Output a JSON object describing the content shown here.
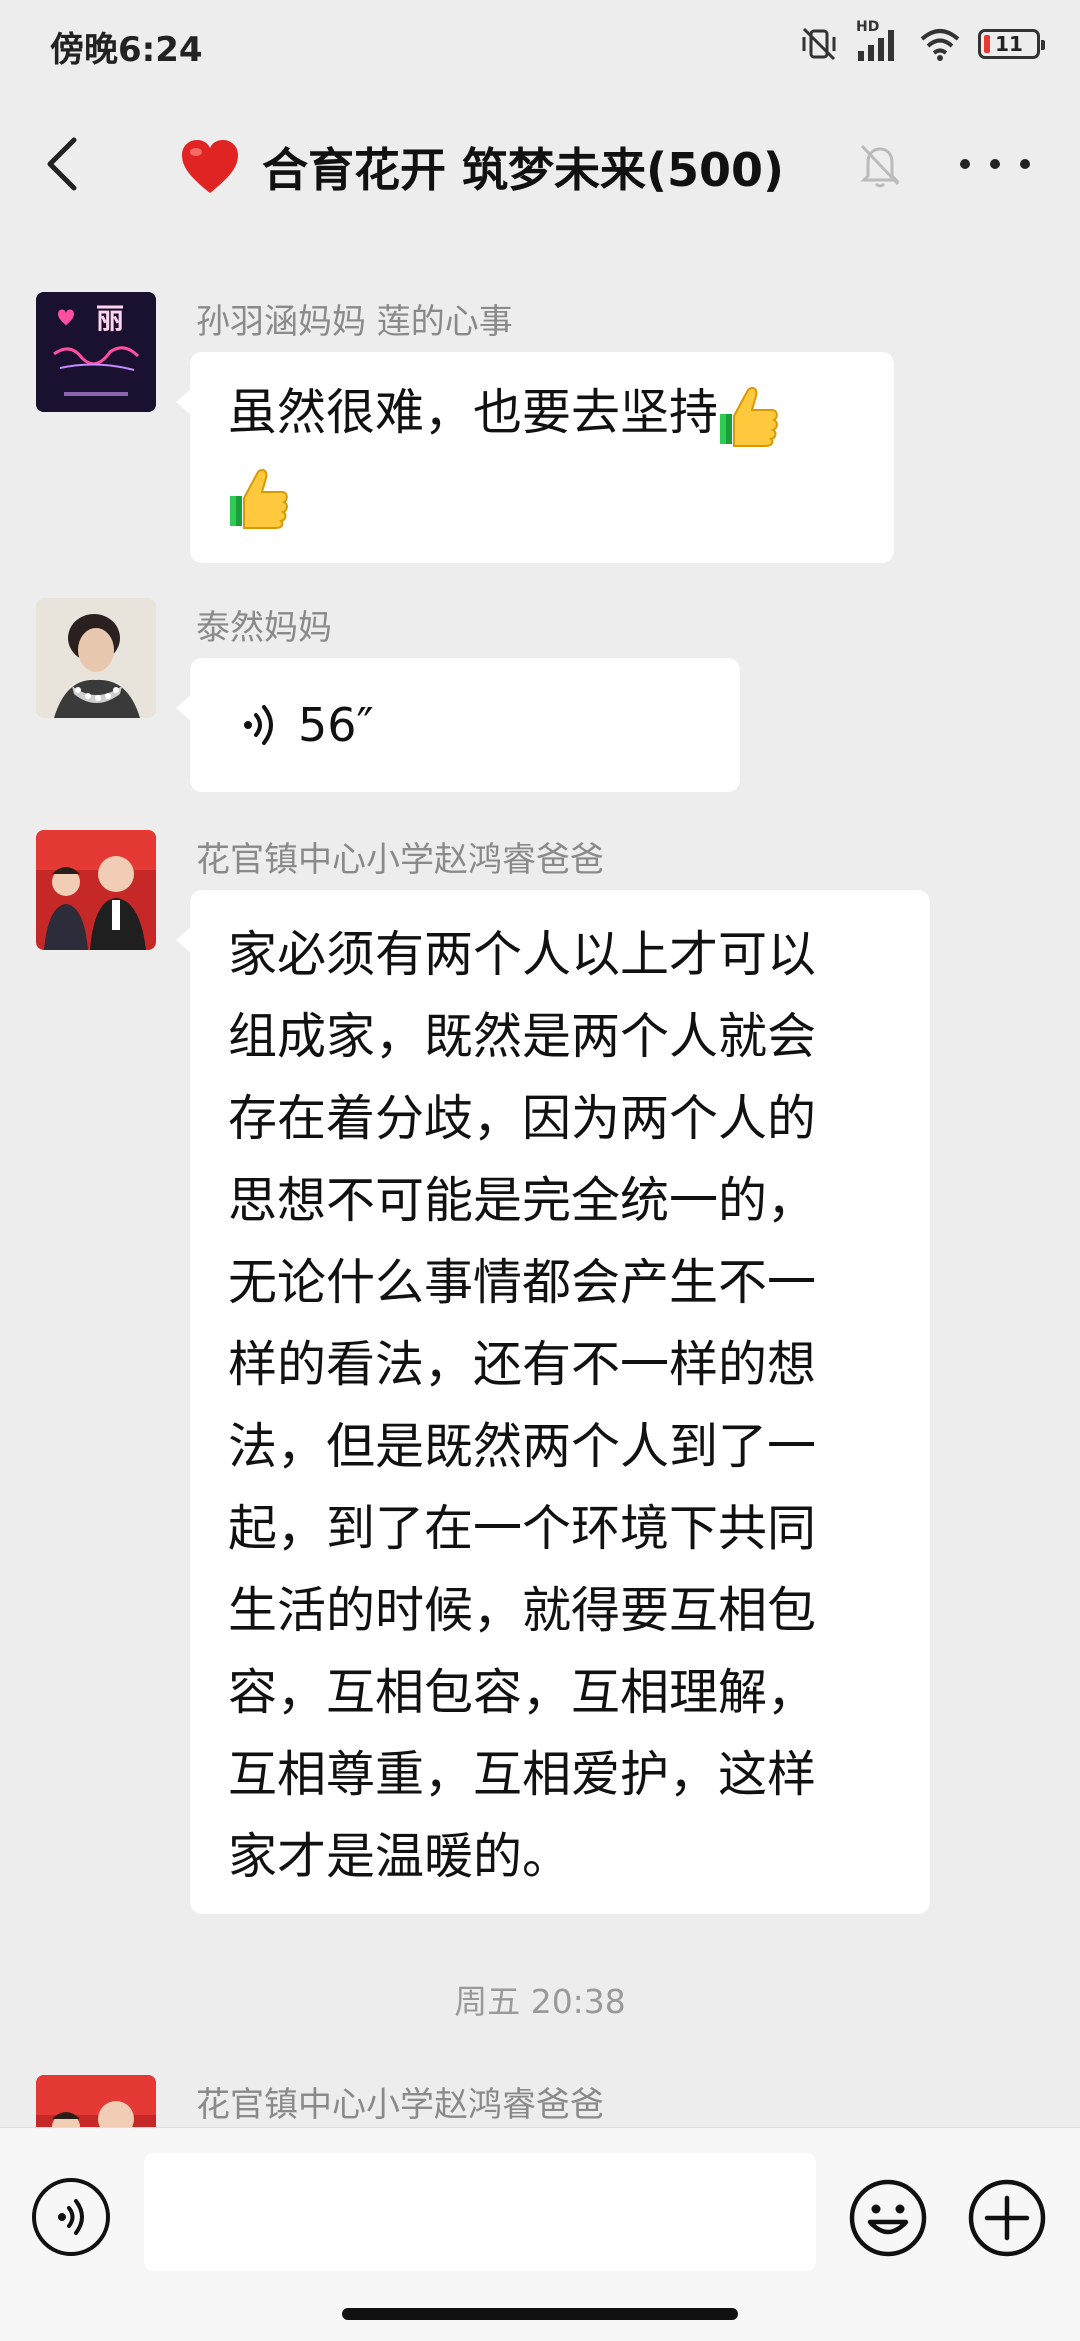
{
  "status_bar": {
    "time": "傍晚6:24",
    "battery_level": "11",
    "network_label": "HD"
  },
  "header": {
    "title": "合育花开 筑梦未来(500)"
  },
  "messages": [
    {
      "sender": "孙羽涵妈妈  莲的心事",
      "text_lines": [
        "虽然很难，也要去坚持"
      ],
      "avatar_text": "丽",
      "emoji": [
        "thumbs-up",
        "thumbs-up"
      ]
    },
    {
      "sender": "泰然妈妈",
      "voice_duration": "56″"
    },
    {
      "sender": "花官镇中心小学赵鸿睿爸爸",
      "text_lines": [
        "家必须有两个人以上才可以",
        "组成家，既然是两个人就会",
        "存在着分歧，因为两个人的",
        "思想不可能是完全统一的，",
        "无论什么事情都会产生不一",
        "样的看法，还有不一样的想",
        "法，但是既然两个人到了一",
        "起，到了在一个环境下共同",
        "生活的时候，就得要互相包",
        "容，互相包容，互相理解，",
        "互相尊重，互相爱护，这样",
        "家才是温暖的。"
      ]
    },
    {
      "sender": "花官镇中心小学赵鸿睿爸爸"
    }
  ],
  "timestamp": "周五 20:38",
  "input": {
    "placeholder": ""
  },
  "icons": {
    "back": "chevron-left-icon",
    "heart": "red-heart-icon",
    "mute": "bell-off-icon",
    "more": "more-dots-icon",
    "voice": "voice-mode-icon",
    "emoji": "emoji-smile-icon",
    "plus": "plus-circle-icon"
  }
}
